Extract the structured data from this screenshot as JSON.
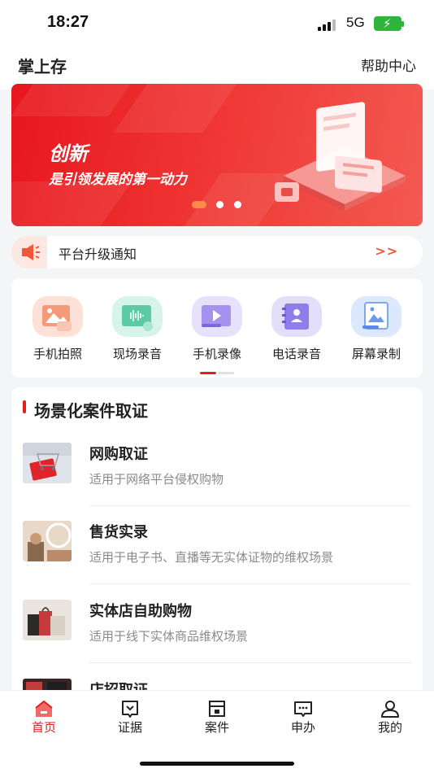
{
  "status_bar": {
    "time": "18:27",
    "network": "5G",
    "battery_color": "#2fb43c"
  },
  "header": {
    "title": "掌上存",
    "help_label": "帮助中心"
  },
  "banner": {
    "title": "创新",
    "subtitle": "是引领发展的第一动力",
    "active_slide": 1,
    "slide_count": 3,
    "accent": "#e8161d"
  },
  "notice": {
    "icon": "megaphone-icon",
    "text": "平台升级通知",
    "more_label": ">>",
    "accent": "#f2573a"
  },
  "features": [
    {
      "label": "手机拍照",
      "icon": "photo-icon",
      "color": "#f8b49c"
    },
    {
      "label": "现场录音",
      "icon": "audio-wave-icon",
      "color": "#69d3b0"
    },
    {
      "label": "手机录像",
      "icon": "video-icon",
      "color": "#b7a8f3"
    },
    {
      "label": "电话录音",
      "icon": "contact-book-icon",
      "color": "#9c8df0"
    },
    {
      "label": "屏幕录制",
      "icon": "screen-image-icon",
      "color": "#8fb4f5"
    }
  ],
  "features_pager": {
    "active_page": 1,
    "page_count": 2,
    "accent": "#e51d1d"
  },
  "scenes": {
    "title": "场景化案件取证",
    "items": [
      {
        "name": "网购取证",
        "desc": "适用于网络平台侵权购物"
      },
      {
        "name": "售货实录",
        "desc": "适用于电子书、直播等无实体证物的维权场景"
      },
      {
        "name": "实体店自助购物",
        "desc": "适用于线下实体商品维权场景"
      },
      {
        "name": "店招取证",
        "desc": ""
      }
    ]
  },
  "tabbar": {
    "active_color": "#e51d1d",
    "items": [
      {
        "label": "首页",
        "icon": "home-icon",
        "active": true
      },
      {
        "label": "证据",
        "icon": "evidence-icon",
        "active": false
      },
      {
        "label": "案件",
        "icon": "case-box-icon",
        "active": false
      },
      {
        "label": "申办",
        "icon": "apply-message-icon",
        "active": false
      },
      {
        "label": "我的",
        "icon": "user-icon",
        "active": false
      }
    ]
  }
}
